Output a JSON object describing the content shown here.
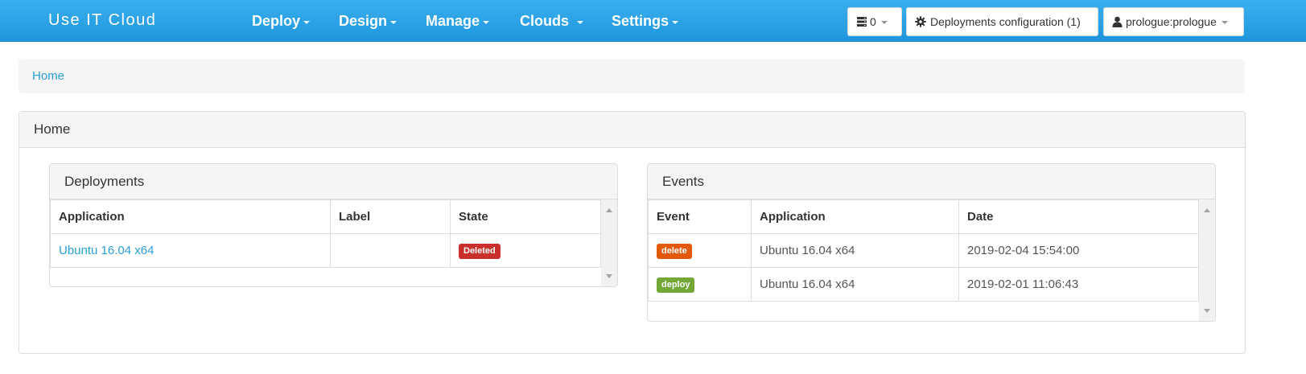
{
  "navbar": {
    "brand": "Use IT Cloud",
    "menu": [
      {
        "label": "Deploy"
      },
      {
        "label": "Design"
      },
      {
        "label": "Manage"
      },
      {
        "label": "Clouds"
      },
      {
        "label": "Settings"
      }
    ],
    "server_count": "0",
    "deploy_config_label": "Deployments configuration (1)",
    "user_label": "prologue:prologue",
    "server_icon": "server-icon",
    "gear_icon": "gear-icon",
    "user_icon": "user-icon"
  },
  "breadcrumb": {
    "home": "Home"
  },
  "main": {
    "title": "Home",
    "deployments": {
      "title": "Deployments",
      "columns": [
        "Application",
        "Label",
        "State"
      ],
      "rows": [
        {
          "application": "Ubuntu 16.04 x64",
          "label": "",
          "state": "Deleted"
        }
      ],
      "state_color": "#c9302c"
    },
    "events": {
      "title": "Events",
      "columns": [
        "Event",
        "Application",
        "Date"
      ],
      "rows": [
        {
          "event": "delete",
          "application": "Ubuntu 16.04 x64",
          "date": "2019-02-04 15:54:00"
        },
        {
          "event": "deploy",
          "application": "Ubuntu 16.04 x64",
          "date": "2019-02-01 11:06:43"
        }
      ],
      "event_colors": {
        "delete": "#e3590c",
        "deploy": "#73a839"
      }
    }
  },
  "colors": {
    "navbar": "#2a9fd6",
    "link": "#2a9fd6"
  }
}
